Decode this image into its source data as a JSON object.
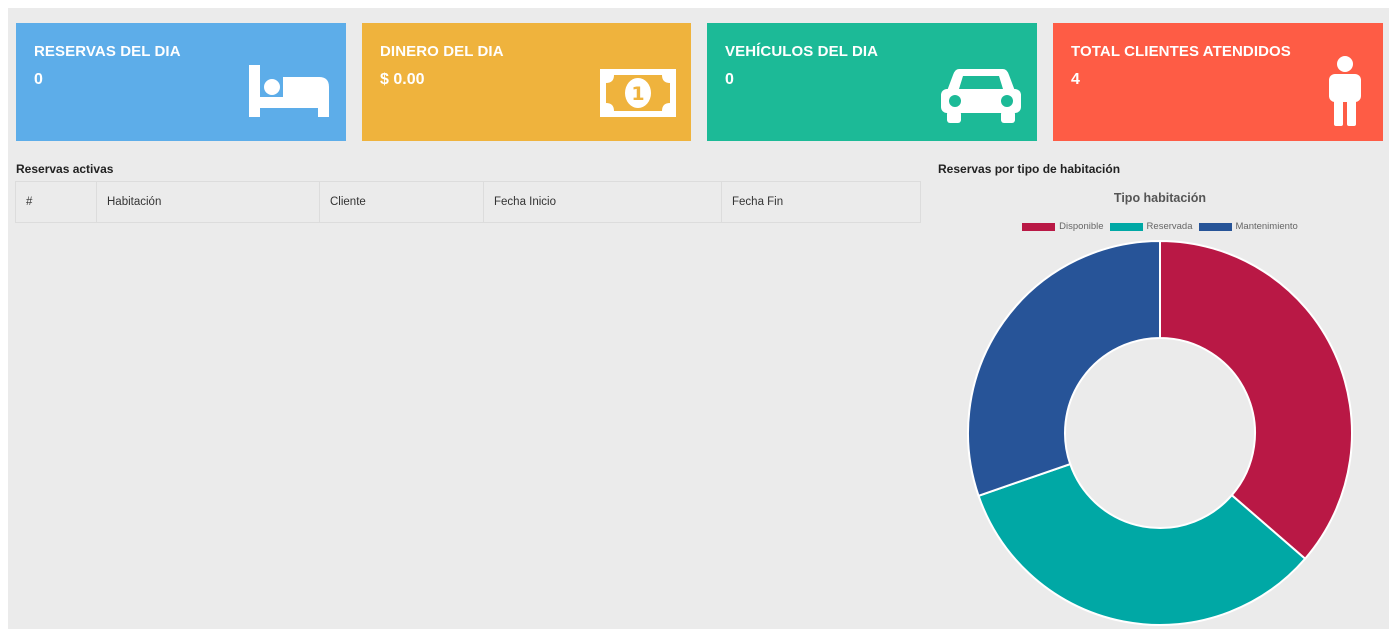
{
  "cards": [
    {
      "label": "RESERVAS DEL DIA",
      "value": "0",
      "color": "#5dade9",
      "icon": "bed-icon"
    },
    {
      "label": "DINERO DEL DIA",
      "value": "$ 0.00",
      "color": "#efb33d",
      "icon": "money-bill-icon"
    },
    {
      "label": "VEHÍCULOS DEL DIA",
      "value": "0",
      "color": "#1cba97",
      "icon": "car-icon"
    },
    {
      "label": "TOTAL CLIENTES ATENDIDOS",
      "value": "4",
      "color": "#fe5c45",
      "icon": "person-icon"
    }
  ],
  "reservas": {
    "title": "Reservas activas",
    "columns": [
      "#",
      "Habitación",
      "Cliente",
      "Fecha Inicio",
      "Fecha Fin"
    ],
    "rows": []
  },
  "chart_section": {
    "title": "Reservas por tipo de habitación"
  },
  "chart_data": {
    "type": "pie",
    "title": "Tipo habitación",
    "categories": [
      "Disponible",
      "Reservada",
      "Mantenimiento"
    ],
    "values": [
      12,
      11,
      10
    ],
    "colors": [
      "#b91845",
      "#00a8a5",
      "#275498"
    ],
    "legend": "top",
    "donut": true
  }
}
